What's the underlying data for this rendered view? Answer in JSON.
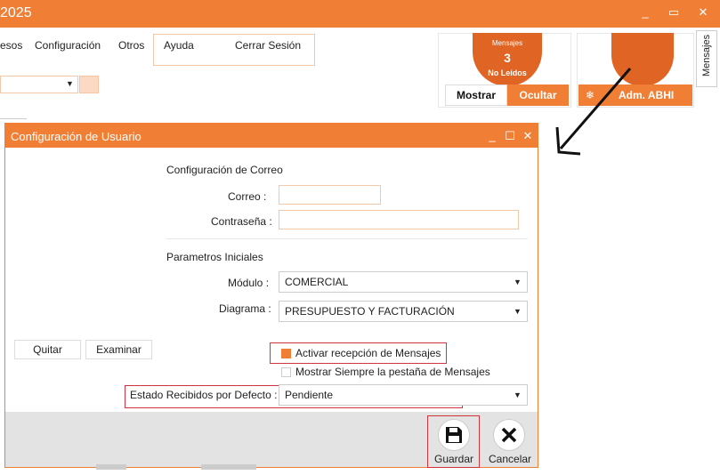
{
  "window": {
    "title": "2025",
    "controls": {
      "minimize": "_",
      "restore": "▭",
      "close": "✕"
    }
  },
  "menu": {
    "items": [
      "esos",
      "Configuración",
      "Otros",
      "Ayuda",
      "Cerrar Sesión"
    ]
  },
  "messages_panel": {
    "title": "Mensajes",
    "count": "3",
    "status": "No Leídos",
    "show_label": "Mostrar",
    "hide_label": "Ocultar"
  },
  "user_panel": {
    "user_label": "Adm. ABHI",
    "icon": "snowflake-icon"
  },
  "side_tab": {
    "label": "Mensajes"
  },
  "dialog": {
    "title": "Configuración de Usuario",
    "controls": {
      "minimize": "_",
      "maximize": "☐",
      "close": "✕"
    },
    "email_section": {
      "title": "Configuración de Correo",
      "email_label": "Correo :",
      "email_value": "",
      "password_label": "Contraseña :",
      "password_value": ""
    },
    "params_section": {
      "title": "Parametros Iniciales",
      "module_label": "Módulo :",
      "module_value": "COMERCIAL",
      "diagram_label": "Diagrama :",
      "diagram_value": "PRESUPUESTO Y FACTURACIÓN"
    },
    "buttons": {
      "remove": "Quitar",
      "browse": "Examinar"
    },
    "checkboxes": {
      "activate_messages": "Activar recepción de Mensajes",
      "always_show_tab": "Mostrar Siempre la pestaña de Mensajes"
    },
    "default_status": {
      "label": "Estado Recibidos por Defecto :",
      "value": "Pendiente"
    },
    "footer": {
      "save_label": "Guardar",
      "cancel_label": "Cancelar"
    }
  },
  "colors": {
    "accent": "#f07f35",
    "accent_dark": "#e06424",
    "highlight": "#d0343c"
  }
}
